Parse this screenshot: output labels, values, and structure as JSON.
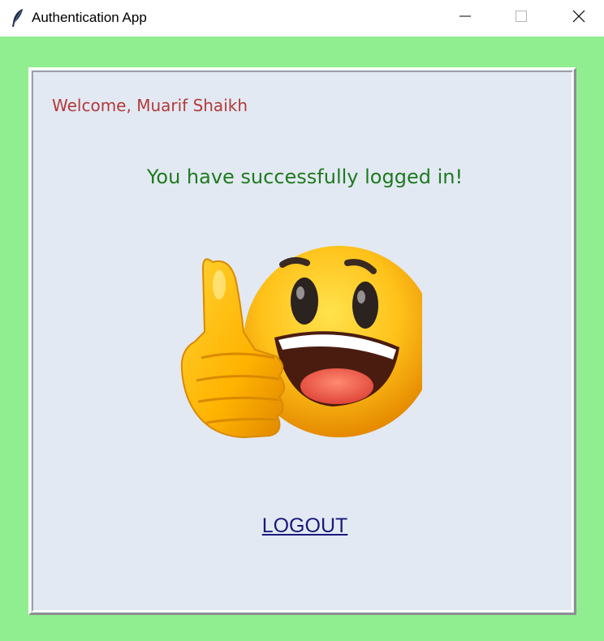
{
  "window": {
    "title": "Authentication App",
    "icons": {
      "app": "feather-icon",
      "minimize": "minimize-icon",
      "maximize": "maximize-icon",
      "close": "close-icon"
    }
  },
  "colors": {
    "background": "#90ee90",
    "panel": "#e2e9f3",
    "welcome_text": "#b23a3a",
    "success_text": "#1e7a1e",
    "logout_link": "#1a1a7a"
  },
  "panel": {
    "welcome": "Welcome, Muarif Shaikh",
    "message": "You have successfully logged in!",
    "image": "thumbs-up-smiley",
    "logout_label": "LOGOUT"
  }
}
